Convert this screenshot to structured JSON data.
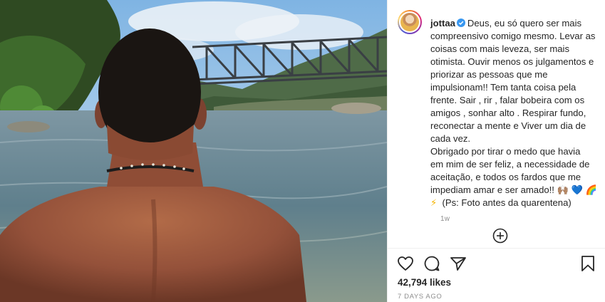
{
  "post": {
    "username": "jottaa",
    "caption_lines": [
      "Deus, eu só quero ser mais",
      "compreensivo comigo mesmo. Levar as",
      "coisas com mais leveza, ser mais",
      "otimista. Ouvir menos os julgamentos e",
      "priorizar as pessoas que me",
      "impulsionam!! Tem tanta coisa pela",
      "frente. Sair , rir , falar bobeira com os",
      "amigos , sonhar alto . Respirar fundo,",
      "reconectar a mente e Viver um dia de",
      "cada vez.",
      "Obrigado por tirar o medo que havia",
      "em mim de ser feliz, a necessidade de",
      "aceitação, e todos os fardos que me",
      "impediam amar e ser amado!!",
      "(Ps: Foto antes da quarentena)"
    ],
    "emoji_line1": "🙌🏽 💙 🌈",
    "emoji_line2": "⚡",
    "time_ago": "1w",
    "likes": "42,794 likes",
    "date": "7 DAYS AGO"
  },
  "colors": {
    "verified": "#3897f0",
    "text": "#262626",
    "muted": "#8e8e8e"
  },
  "icons": {
    "verified": "verified-badge-icon",
    "add_comment": "add-circle-icon",
    "like": "heart-icon",
    "comment": "comment-bubble-icon",
    "share": "paper-plane-icon",
    "save": "bookmark-icon"
  }
}
